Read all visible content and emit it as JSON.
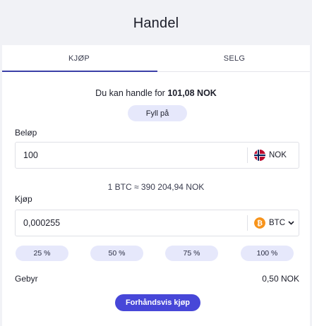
{
  "header": {
    "title": "Handel"
  },
  "tabs": [
    {
      "label": "KJØP",
      "active": true
    },
    {
      "label": "SELG",
      "active": false
    }
  ],
  "balance": {
    "prefix": "Du kan handle for",
    "amount": "101,08 NOK"
  },
  "topup_label": "Fyll på",
  "amount_field": {
    "label": "Beløp",
    "value": "100",
    "currency": "NOK",
    "currency_icon": "norway-flag-icon"
  },
  "rate_text": "1 BTC ≈ 390 204,94 NOK",
  "buy_field": {
    "label": "Kjøp",
    "value": "0,000255",
    "currency": "BTC",
    "currency_icon": "bitcoin-icon"
  },
  "percent_buttons": [
    "25 %",
    "50 %",
    "75 %",
    "100 %"
  ],
  "fee": {
    "label": "Gebyr",
    "value": "0,50 NOK"
  },
  "preview_label": "Forhåndsvis kjøp",
  "colors": {
    "accent": "#4747d8",
    "pill": "#e6e8fb",
    "bitcoin": "#f7931a"
  }
}
